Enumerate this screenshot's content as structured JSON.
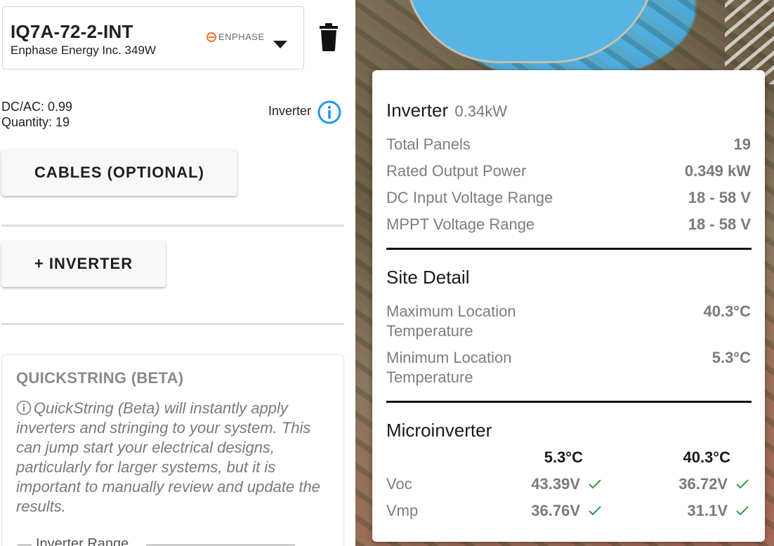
{
  "inverter_card": {
    "model": "IQ7A-72-2-INT",
    "subtitle": "Enphase Energy Inc. 349W",
    "brand": "ENPHASE"
  },
  "stats": {
    "dc_ac": "DC/AC: 0.99",
    "quantity": "Quantity: 19",
    "inverter_label": "Inverter"
  },
  "buttons": {
    "cables": "CABLES (OPTIONAL)",
    "add_inverter": "+ INVERTER"
  },
  "quickstring": {
    "title": "QUICKSTRING (BETA)",
    "description": "QuickString (Beta) will instantly apply inverters and stringing to your system. This can jump start your electrical designs, particularly for larger systems, but it is important to manually review and update the results.",
    "range_label": "Inverter Range"
  },
  "popup": {
    "inverter": {
      "title": "Inverter",
      "power": "0.34kW",
      "rows": [
        {
          "label": "Total Panels",
          "value": "19"
        },
        {
          "label": "Rated Output Power",
          "value": "0.349 kW"
        },
        {
          "label": "DC Input Voltage Range",
          "value": "18 - 58 V"
        },
        {
          "label": "MPPT Voltage Range",
          "value": "18 - 58 V"
        }
      ]
    },
    "site": {
      "title": "Site Detail",
      "rows": [
        {
          "label_line1": "Maximum Location",
          "label_line2": "Temperature",
          "value": "40.3°C"
        },
        {
          "label_line1": "Minimum Location",
          "label_line2": "Temperature",
          "value": "5.3°C"
        }
      ]
    },
    "micro": {
      "title": "Microinverter",
      "col1": "5.3°C",
      "col2": "40.3°C",
      "rows": [
        {
          "label": "Voc",
          "v1": "43.39V",
          "v2": "36.72V"
        },
        {
          "label": "Vmp",
          "v1": "36.76V",
          "v2": "31.1V"
        }
      ]
    }
  },
  "colors": {
    "accent_blue": "#2196f3",
    "check_green": "#2e9b4a",
    "brand_orange": "#f3742a"
  }
}
